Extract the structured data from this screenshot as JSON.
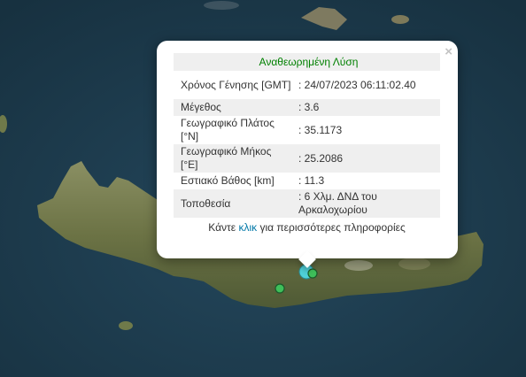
{
  "popup": {
    "title": "Αναθεωρημένη Λύση",
    "close_label": "×",
    "rows": [
      {
        "label": "Χρόνος Γένησης [GMT]",
        "value": ": 24/07/2023 06:11:02.40"
      },
      {
        "label": "Μέγεθος",
        "value": ": 3.6"
      },
      {
        "label": "Γεωγραφικό Πλάτος [°N]",
        "value": ": 35.1173"
      },
      {
        "label": "Γεωγραφικό Μήκος [°E]",
        "value": ": 25.2086"
      },
      {
        "label": "Εστιακό Βάθος [km]",
        "value": ": 11.3"
      },
      {
        "label": "Τοποθεσία",
        "value": ": 6 Χλμ. ΔΝΔ του Αρκαλοχωρίου"
      }
    ],
    "more": {
      "prefix": "Κάντε ",
      "link": "κλικ",
      "suffix": " για περισσότερες πληροφορίες"
    }
  },
  "colors": {
    "sea": "#1d3b4d",
    "land": "#6f7a4a",
    "marker_cyan": "#4fd0d8",
    "marker_green": "#3fbf5a",
    "title_green": "#008000",
    "link": "#0078a8"
  }
}
